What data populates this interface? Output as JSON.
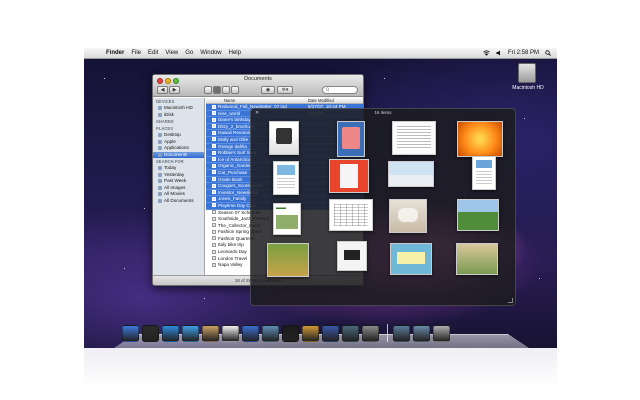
{
  "menubar": {
    "apple_glyph": "",
    "items": [
      "Finder",
      "File",
      "Edit",
      "View",
      "Go",
      "Window",
      "Help"
    ],
    "clock": "Fri 2:58 PM"
  },
  "desktop": {
    "hd_label": "Macintosh HD"
  },
  "finder": {
    "title": "Documents",
    "search_placeholder": "Q",
    "status": "18 of 28 Items selected",
    "columns": {
      "name": "Name",
      "date": "Date Modified"
    },
    "sidebar": {
      "devices_head": "DEVICES",
      "devices": [
        "Macintosh HD",
        "iDisk"
      ],
      "shared_head": "SHARED",
      "places_head": "PLACES",
      "places": [
        "Desktop",
        "Apple",
        "Applications",
        "Documents"
      ],
      "search_head": "SEARCH FOR",
      "searches": [
        "Today",
        "Yesterday",
        "Past Week",
        "All Images",
        "All Movies",
        "All Documents"
      ]
    },
    "rows": [
      {
        "name": "Redwood_Fall_Newsletter_07.ind",
        "date": "6/27/07, 10:44 PM",
        "selected": true
      },
      {
        "name": "nine_world",
        "date": "6/27/07",
        "selected": true
      },
      {
        "name": "Diane's birthday",
        "date": "",
        "selected": true
      },
      {
        "name": "Ditzy_2_brochure",
        "date": "",
        "selected": true
      },
      {
        "name": "Hawaii Reunion",
        "date": "",
        "selected": true
      },
      {
        "name": "Molly and Ollie",
        "date": "",
        "selected": true
      },
      {
        "name": "Orange dahlia",
        "date": "",
        "selected": true
      },
      {
        "name": "Robbie's Surf Shop",
        "date": "",
        "selected": true
      },
      {
        "name": "Ice of Antarctica",
        "date": "",
        "selected": true
      },
      {
        "name": "Organic_Garden",
        "date": "",
        "selected": true
      },
      {
        "name": "Car_Purchase",
        "date": "",
        "selected": true
      },
      {
        "name": "Grade Book",
        "date": "",
        "selected": true
      },
      {
        "name": "Cougars_Scoreboard",
        "date": "",
        "selected": true
      },
      {
        "name": "Investor_Newsletter",
        "date": "",
        "selected": true
      },
      {
        "name": "Jones_Family",
        "date": "",
        "selected": true
      },
      {
        "name": "Playtime Day Care",
        "date": "",
        "selected": true
      },
      {
        "name": "Season 07 Schedule",
        "date": "",
        "selected": false
      },
      {
        "name": "Southside_Jazz_Festival",
        "date": "",
        "selected": false
      },
      {
        "name": "The_Collector_Issue",
        "date": "",
        "selected": false
      },
      {
        "name": "Fashion Spring Show",
        "date": "",
        "selected": false
      },
      {
        "name": "Fashion Quarterly",
        "date": "",
        "selected": false
      },
      {
        "name": "Italy bike trip",
        "date": "",
        "selected": false
      },
      {
        "name": "Leonardo Day",
        "date": "",
        "selected": false
      },
      {
        "name": "London Travel",
        "date": "",
        "selected": false
      },
      {
        "name": "Napa Valley",
        "date": "",
        "selected": false
      }
    ]
  },
  "quicklook": {
    "title": "16 items",
    "close_glyph": "✕"
  },
  "dock": {
    "icons": [
      "finder-icon",
      "dashboard-icon",
      "safari-icon",
      "ichat-icon",
      "address-book-icon",
      "ical-icon",
      "itunes-icon",
      "iphoto-icon",
      "imovie-icon",
      "garageband-icon",
      "spaces-icon",
      "time-machine-icon",
      "system-preferences-icon",
      "documents-stack-icon",
      "downloads-stack-icon",
      "trash-icon"
    ]
  }
}
